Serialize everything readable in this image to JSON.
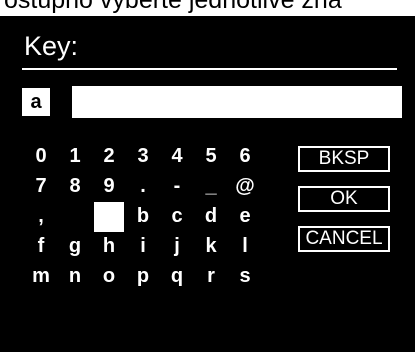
{
  "top_caption": "ostupno vyberte jednotlivé zna",
  "screen": {
    "title": "Key:",
    "selected_char": "a",
    "entry_value": ""
  },
  "keyboard": {
    "rows": [
      [
        "0",
        "1",
        "2",
        "3",
        "4",
        "5",
        "6"
      ],
      [
        "7",
        "8",
        "9",
        ".",
        "-",
        "_",
        "@"
      ],
      [
        ",",
        "",
        "",
        "b",
        "c",
        "d",
        "e"
      ],
      [
        "f",
        "g",
        "h",
        "i",
        "j",
        "k",
        "l"
      ],
      [
        "m",
        "n",
        "o",
        "p",
        "q",
        "r",
        "s"
      ]
    ]
  },
  "buttons": {
    "bksp": "BKSP",
    "ok": "OK",
    "cancel": "CANCEL"
  },
  "colors": {
    "screen_background": "#000000",
    "foreground": "#ffffff"
  }
}
